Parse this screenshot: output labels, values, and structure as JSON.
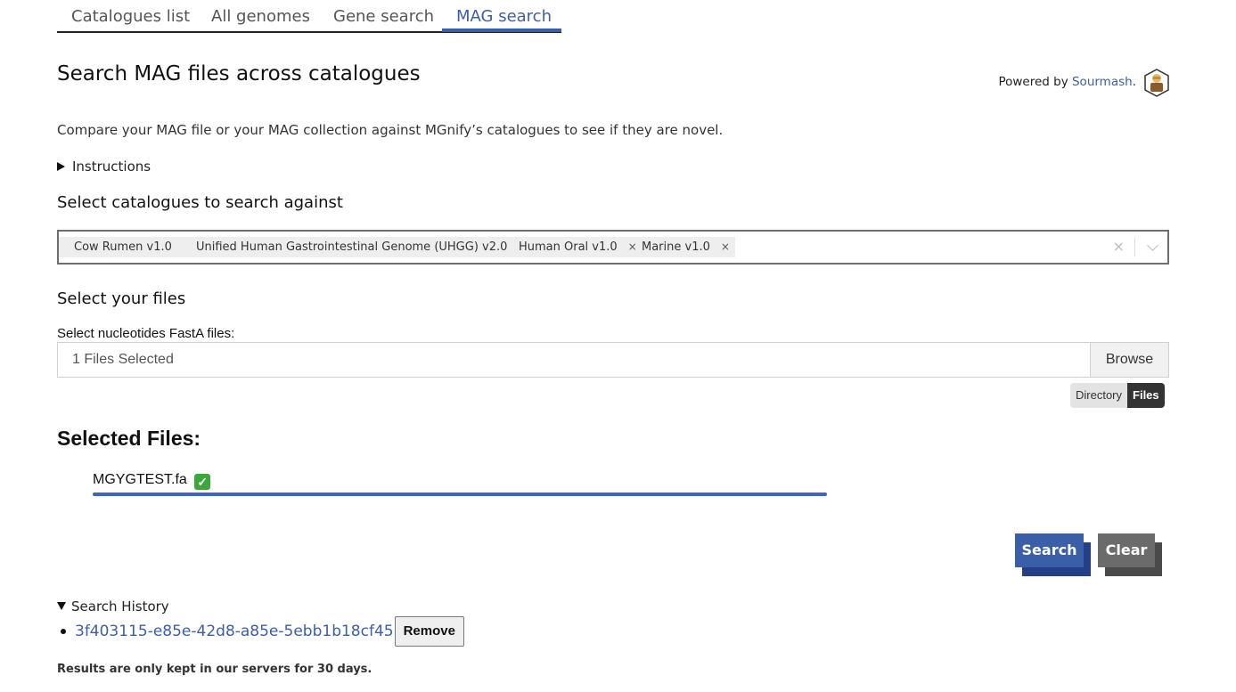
{
  "tabs": [
    {
      "label": "Catalogues list"
    },
    {
      "label": "All genomes"
    },
    {
      "label": "Gene search"
    },
    {
      "label": "MAG search"
    }
  ],
  "active_tab": "MAG search",
  "header": {
    "title": "Search MAG files across catalogues",
    "powered_prefix": "Powered by ",
    "powered_link": "Sourmash",
    "powered_suffix": "."
  },
  "intro": "Compare your MAG file or your MAG collection against MGnify’s catalogues to see if they are novel.",
  "instructions_label": "Instructions",
  "catalogues": {
    "heading": "Select catalogues to search against",
    "selected": [
      "Cow Rumen v1.0",
      "Unified Human Gastrointestinal Genome (UHGG) v2.0",
      "Human Oral v1.0",
      "Marine v1.0"
    ],
    "remove_glyph": "×",
    "clear_glyph": "×"
  },
  "files": {
    "heading": "Select your files",
    "input_label": "Select nucleotides FastA files:",
    "input_value": "1 Files Selected",
    "browse_label": "Browse",
    "mode_options": [
      "Directory",
      "Files"
    ],
    "mode_selected": "Files"
  },
  "selected_files": {
    "heading": "Selected Files:",
    "items": [
      {
        "name": "MGYGTEST.fa",
        "status": "✓",
        "progress": 1.0
      }
    ]
  },
  "actions": {
    "search_label": "Search",
    "clear_label": "Clear"
  },
  "history": {
    "summary": "Search History",
    "items": [
      {
        "id": "3f403115-e85e-42d8-a85e-5ebb1b18cf45",
        "remove_label": "Remove"
      }
    ],
    "note": "Results are only kept in our servers for 30 days."
  },
  "colors": {
    "accent": "#3b5ea8",
    "progress": "#3e64c8",
    "success": "#3ca83c",
    "clear_button": "#6b6b6b"
  }
}
